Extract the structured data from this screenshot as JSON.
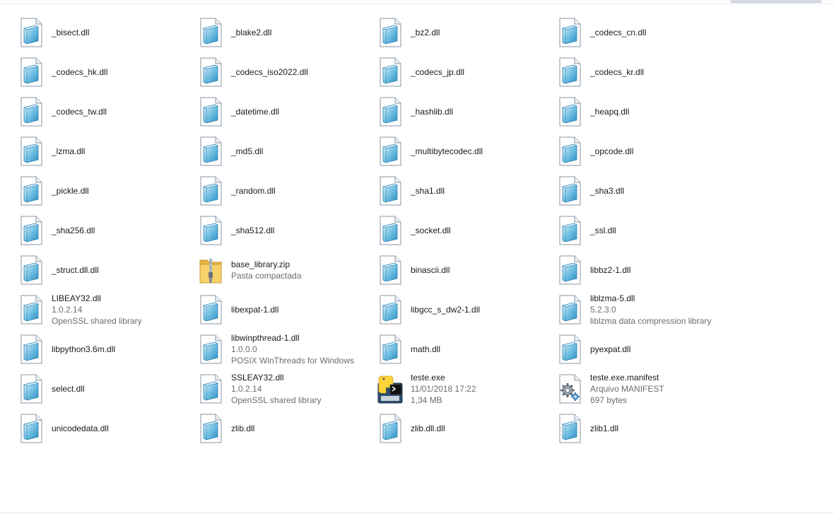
{
  "files": [
    {
      "name": "_bisect.dll",
      "icon": "dll-file-icon",
      "lines": []
    },
    {
      "name": "_blake2.dll",
      "icon": "dll-file-icon",
      "lines": []
    },
    {
      "name": "_bz2.dll",
      "icon": "dll-file-icon",
      "lines": []
    },
    {
      "name": "_codecs_cn.dll",
      "icon": "dll-file-icon",
      "lines": []
    },
    {
      "name": "_codecs_hk.dll",
      "icon": "dll-file-icon",
      "lines": []
    },
    {
      "name": "_codecs_iso2022.dll",
      "icon": "dll-file-icon",
      "lines": []
    },
    {
      "name": "_codecs_jp.dll",
      "icon": "dll-file-icon",
      "lines": []
    },
    {
      "name": "_codecs_kr.dll",
      "icon": "dll-file-icon",
      "lines": []
    },
    {
      "name": "_codecs_tw.dll",
      "icon": "dll-file-icon",
      "lines": []
    },
    {
      "name": "_datetime.dll",
      "icon": "dll-file-icon",
      "lines": []
    },
    {
      "name": "_hashlib.dll",
      "icon": "dll-file-icon",
      "lines": []
    },
    {
      "name": "_heapq.dll",
      "icon": "dll-file-icon",
      "lines": []
    },
    {
      "name": "_lzma.dll",
      "icon": "dll-file-icon",
      "lines": []
    },
    {
      "name": "_md5.dll",
      "icon": "dll-file-icon",
      "lines": []
    },
    {
      "name": "_multibytecodec.dll",
      "icon": "dll-file-icon",
      "lines": []
    },
    {
      "name": "_opcode.dll",
      "icon": "dll-file-icon",
      "lines": []
    },
    {
      "name": "_pickle.dll",
      "icon": "dll-file-icon",
      "lines": []
    },
    {
      "name": "_random.dll",
      "icon": "dll-file-icon",
      "lines": []
    },
    {
      "name": "_sha1.dll",
      "icon": "dll-file-icon",
      "lines": []
    },
    {
      "name": "_sha3.dll",
      "icon": "dll-file-icon",
      "lines": []
    },
    {
      "name": "_sha256.dll",
      "icon": "dll-file-icon",
      "lines": []
    },
    {
      "name": "_sha512.dll",
      "icon": "dll-file-icon",
      "lines": []
    },
    {
      "name": "_socket.dll",
      "icon": "dll-file-icon",
      "lines": []
    },
    {
      "name": "_ssl.dll",
      "icon": "dll-file-icon",
      "lines": []
    },
    {
      "name": "_struct.dll.dll",
      "icon": "dll-file-icon",
      "lines": []
    },
    {
      "name": "base_library.zip",
      "icon": "zip-folder-icon",
      "lines": [
        "Pasta compactada"
      ]
    },
    {
      "name": "binascii.dll",
      "icon": "dll-file-icon",
      "lines": []
    },
    {
      "name": "libbz2-1.dll",
      "icon": "dll-file-icon",
      "lines": []
    },
    {
      "name": "LIBEAY32.dll",
      "icon": "dll-file-icon",
      "lines": [
        "1.0.2.14",
        "OpenSSL shared library"
      ]
    },
    {
      "name": "libexpat-1.dll",
      "icon": "dll-file-icon",
      "lines": []
    },
    {
      "name": "libgcc_s_dw2-1.dll",
      "icon": "dll-file-icon",
      "lines": []
    },
    {
      "name": "liblzma-5.dll",
      "icon": "dll-file-icon",
      "lines": [
        "5.2.3.0",
        "liblzma data compression library"
      ]
    },
    {
      "name": "libpython3.6m.dll",
      "icon": "dll-file-icon",
      "lines": []
    },
    {
      "name": "libwinpthread-1.dll",
      "icon": "dll-file-icon",
      "lines": [
        "1.0.0.0",
        "POSIX WinThreads for Windows"
      ]
    },
    {
      "name": "math.dll",
      "icon": "dll-file-icon",
      "lines": []
    },
    {
      "name": "pyexpat.dll",
      "icon": "dll-file-icon",
      "lines": []
    },
    {
      "name": "select.dll",
      "icon": "dll-file-icon",
      "lines": []
    },
    {
      "name": "SSLEAY32.dll",
      "icon": "dll-file-icon",
      "lines": [
        "1.0.2.14",
        "OpenSSL shared library"
      ]
    },
    {
      "name": "teste.exe",
      "icon": "python-exe-icon",
      "lines": [
        "11/01/2018 17:22",
        "1,34 MB"
      ]
    },
    {
      "name": "teste.exe.manifest",
      "icon": "manifest-gear-icon",
      "lines": [
        "Arquivo MANIFEST",
        "697 bytes"
      ]
    },
    {
      "name": "unicodedata.dll",
      "icon": "dll-file-icon",
      "lines": []
    },
    {
      "name": "zlib.dll",
      "icon": "dll-file-icon",
      "lines": []
    },
    {
      "name": "zlib.dll.dll",
      "icon": "dll-file-icon",
      "lines": []
    },
    {
      "name": "zlib1.dll",
      "icon": "dll-file-icon",
      "lines": []
    }
  ],
  "colors": {
    "background": "#ffffff",
    "name_text": "#1a1a1a",
    "detail_text": "#6d6d6d",
    "dll_page_blue": "#3fa4cf",
    "zip_folder_yellow": "#f5cc5c",
    "python_blue": "#3570a3",
    "python_yellow": "#ffd43b"
  }
}
